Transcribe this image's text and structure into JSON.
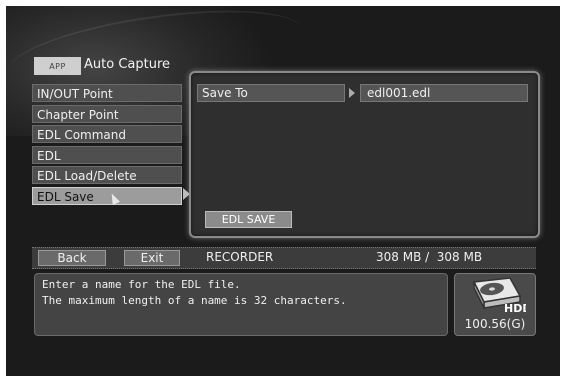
{
  "app": {
    "tag": "APP",
    "title": "Auto Capture"
  },
  "menu": {
    "items": [
      {
        "label": "IN/OUT Point"
      },
      {
        "label": "Chapter Point"
      },
      {
        "label": "EDL Command"
      },
      {
        "label": "EDL"
      },
      {
        "label": "EDL Load/Delete"
      },
      {
        "label": "EDL Save"
      }
    ],
    "selected": "EDL Save"
  },
  "panel": {
    "save_to_label": "Save To",
    "save_to_value": "edl001.edl",
    "edl_save_button": "EDL SAVE"
  },
  "bottom_bar": {
    "back": "Back",
    "exit": "Exit",
    "device": "RECORDER",
    "capacity": "308 MB /  308 MB"
  },
  "message": {
    "line1": "Enter a name for the EDL file.",
    "line2": "The maximum length of a name is 32 characters."
  },
  "hdd": {
    "label": "HDD",
    "size": "100.56(G)"
  }
}
